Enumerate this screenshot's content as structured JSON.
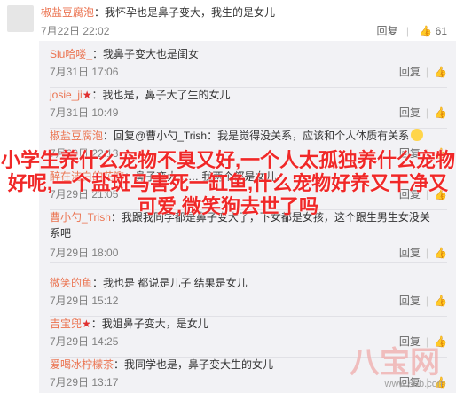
{
  "top_comment": {
    "username": "椒盐豆腐泡",
    "text": "：我怀孕也是鼻子变大，我生的是女儿",
    "time": "7月22日 22:02",
    "reply_label": "回复",
    "like_count": "61"
  },
  "replies": [
    {
      "username": "Slu哈喽_",
      "flag": "",
      "text": "：我鼻子变大也是闺女",
      "time": "7月31日 17:06",
      "reply_label": "回复"
    },
    {
      "username": "josie_ji",
      "flag": "★",
      "text": "：我也是，鼻子大了生的女儿",
      "time": "7月31日 10:49",
      "reply_label": "回复"
    },
    {
      "username": "椒盐豆腐泡",
      "flag": "",
      "text": "：回复@曹小勺_Trish：我是觉得没关系，应该和个人体质有关系",
      "time": "7月29日 22:13",
      "reply_label": "回复"
    },
    {
      "username": "醉在洁白的花瓣",
      "flag": "",
      "text": "：鼻子变大…… 我两个都是女儿",
      "time": "7月29日 21:05",
      "reply_label": "回复"
    },
    {
      "username": "曹小勺_Trish",
      "flag": "",
      "text": "：我跟我同学都是鼻子变大了，下女都是女孩，这个跟生男生女没关系吧",
      "time": "7月29日 18:00",
      "reply_label": "回复"
    },
    {
      "username": "微笑的鱼",
      "flag": "",
      "text": "：我也是 都说是儿子 结果是女儿",
      "time": "7月29日 15:12",
      "reply_label": "回复"
    },
    {
      "username": "吉宝兜",
      "flag": "★",
      "text": "：我姐鼻子变大，是女儿",
      "time": "7月29日 14:25",
      "reply_label": "回复"
    },
    {
      "username": "爱喝冰柠檬茶",
      "flag": "",
      "text": "：我同学也是，鼻子变大生的女儿",
      "time": "7月29日 13:17",
      "reply_label": "回复"
    }
  ],
  "overlay_text": "小学生养什么宠物不臭又好,一个人太孤独养什么宠物好呢,一个盐斑马害死一缸鱼,什么宠物好养又干净又可爱,微笑狗去世了吗",
  "watermark": {
    "text": "八宝网",
    "url": "www.8bb.com"
  },
  "icons": {
    "like": "thumbs-up-icon",
    "flag": "star-badge-icon"
  },
  "colors": {
    "username": "#eb7350",
    "overlay": "#f02828",
    "reply_bg": "#f2f2f5"
  }
}
